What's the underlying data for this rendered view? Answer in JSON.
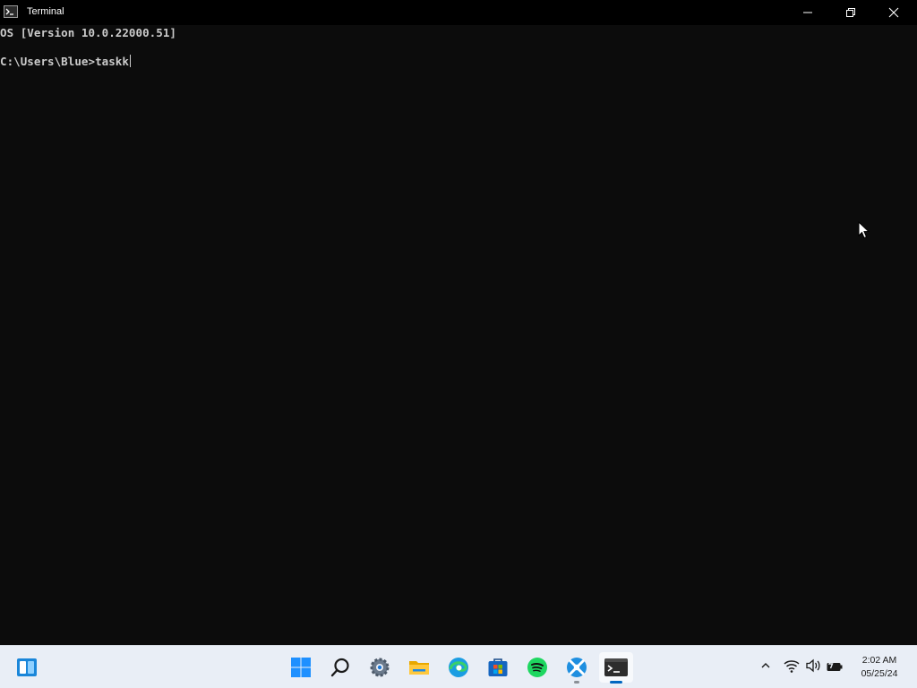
{
  "window": {
    "title": "Terminal",
    "icon": "terminal-icon",
    "controls": [
      "minimize-icon",
      "restore-icon",
      "close-icon"
    ]
  },
  "terminal": {
    "line1": "OS [Version 10.0.22000.51]",
    "prompt": "C:\\Users\\Blue>",
    "input": "taskk"
  },
  "taskbar": {
    "left_icon": "widgets-icon",
    "pinned": [
      "windows-start-icon",
      "search-icon",
      "settings-icon",
      "file-explorer-icon",
      "edge-icon",
      "microsoft-store-icon",
      "spotify-icon",
      "app-icon",
      "terminal-icon"
    ],
    "active": "terminal-icon"
  },
  "tray": {
    "icons": [
      "show-hidden-icons-chevron-icon",
      "wifi-icon",
      "volume-icon",
      "battery-icon"
    ],
    "time": "2:02 AM",
    "date": "05/25/24"
  },
  "colors": {
    "terminal_bg": "#0c0c0c",
    "titlebar_bg": "#000000",
    "terminal_text": "#cccccc",
    "taskbar_bg": "#e9eef6",
    "accent": "#0067c0"
  }
}
